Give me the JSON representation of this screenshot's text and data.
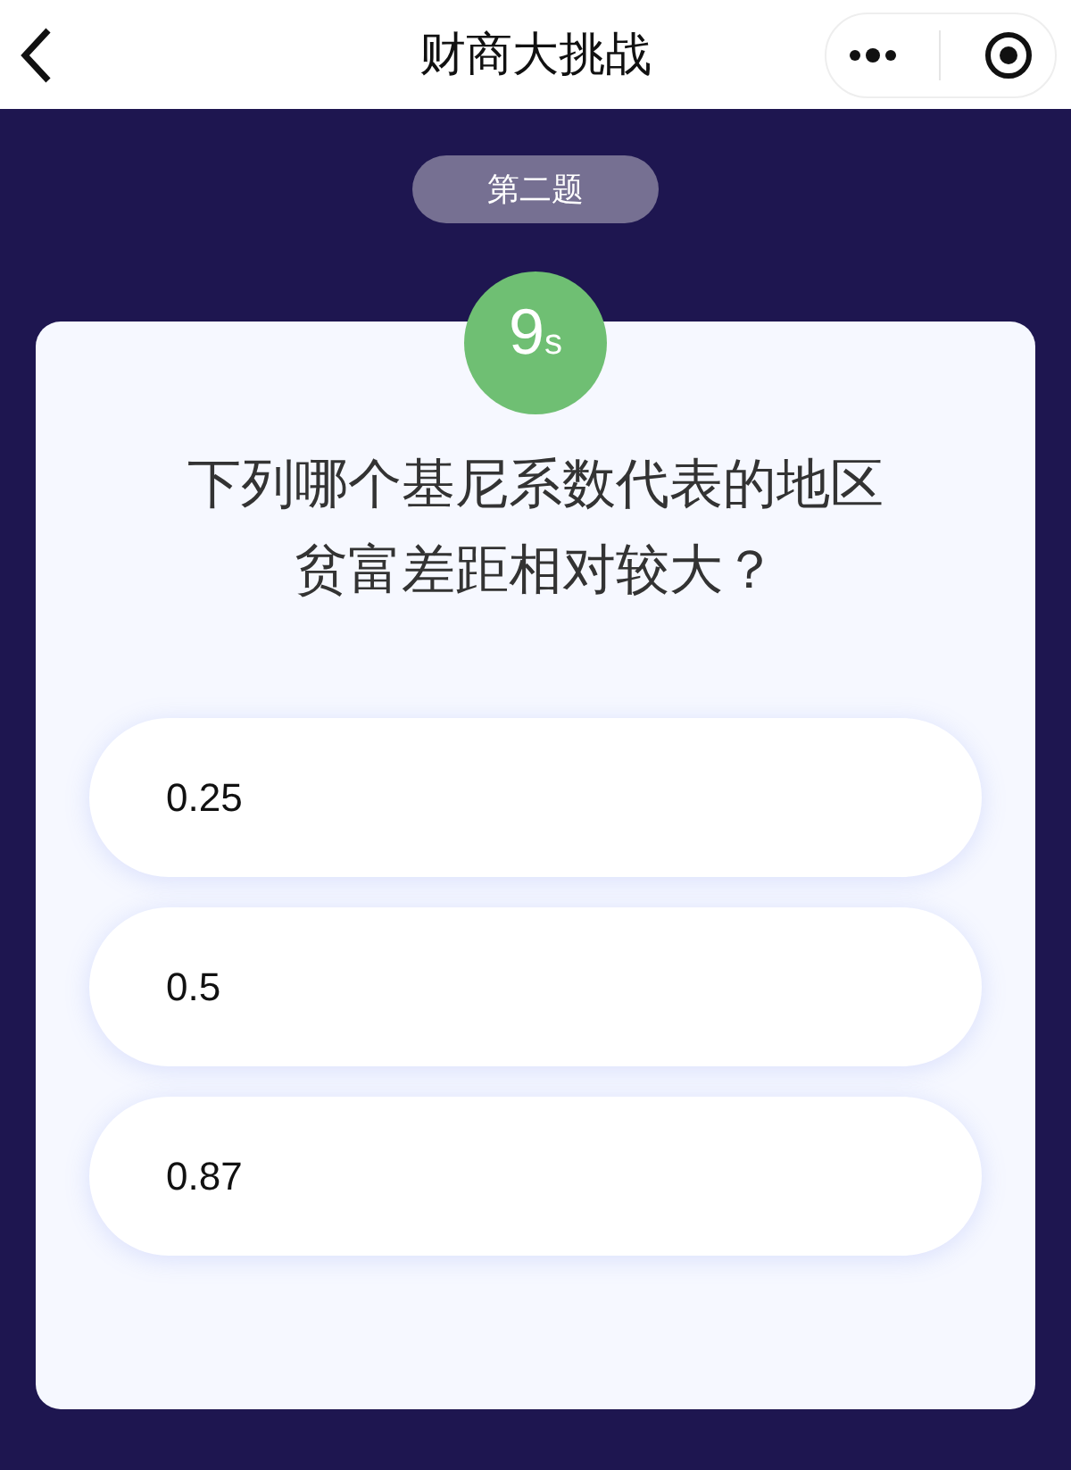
{
  "nav_bar": {
    "title": "财商大挑战"
  },
  "quiz": {
    "round_label": "第二题",
    "timer": {
      "value": "9",
      "unit": "s"
    },
    "question_lines": [
      "下列哪个基尼系数代表的地区",
      "贫富差距相对较大？"
    ],
    "options": [
      {
        "label": "0.25",
        "selected": false
      },
      {
        "label": "0.5",
        "selected": false
      },
      {
        "label": "0.87",
        "selected": false
      }
    ]
  }
}
